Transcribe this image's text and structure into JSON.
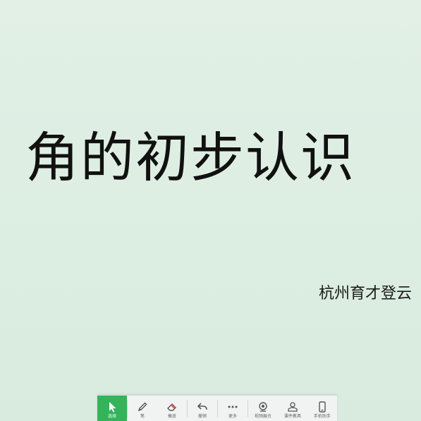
{
  "slide": {
    "title": "角的初步认识",
    "subtitle": "杭州育才登云"
  },
  "toolbar": {
    "tools": [
      {
        "label": "选择",
        "icon": "cursor-icon",
        "active": true
      },
      {
        "label": "笔",
        "icon": "pen-icon",
        "active": false
      },
      {
        "label": "橡皮",
        "icon": "eraser-icon",
        "active": false
      },
      {
        "label": "撤销",
        "icon": "undo-icon",
        "active": false
      },
      {
        "label": "更多",
        "icon": "more-icon",
        "active": false
      },
      {
        "label": "视频展台",
        "icon": "camera-icon",
        "active": false
      },
      {
        "label": "课件教具",
        "icon": "toolbox-icon",
        "active": false
      },
      {
        "label": "手机助手",
        "icon": "phone-icon",
        "active": false
      }
    ]
  },
  "colors": {
    "background": "#dfeee3",
    "accent": "#33b35a",
    "text": "#111111"
  }
}
